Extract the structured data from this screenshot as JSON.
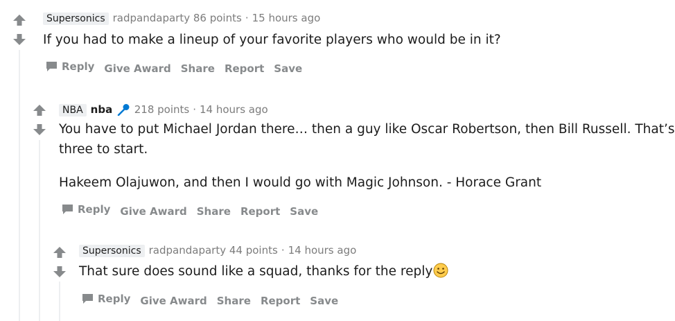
{
  "comments": [
    {
      "flair": "Supersonics",
      "author": "radpandaparty",
      "points": "86 points",
      "time": "15 hours ago",
      "body": [
        "If you had to make a lineup of your favorite players who would be in it?"
      ]
    },
    {
      "flair": "NBA",
      "author": "nba",
      "points": "218 points",
      "time": "14 hours ago",
      "body": [
        "You have to put Michael Jordan there… then a guy like Oscar Robertson, then Bill Russell. That’s",
        "three to start.",
        "Hakeem Olajuwon, and then I would go with Magic Johnson. - Horace Grant"
      ]
    },
    {
      "flair": "Supersonics",
      "author": "radpandaparty",
      "points": "44 points",
      "time": "14 hours ago",
      "body": [
        "That sure does sound like a squad, thanks for the reply"
      ]
    }
  ],
  "actions": {
    "reply": "Reply",
    "give_award": "Give Award",
    "share": "Share",
    "report": "Report",
    "save": "Save"
  },
  "meta_separator": "·",
  "icons": {
    "upvote": "upvote-arrow-icon",
    "downvote": "downvote-arrow-icon",
    "reply": "comment-bubble-icon",
    "mic": "microphone-icon",
    "emoji": "smiley-face-icon"
  },
  "colors": {
    "arrow": "#878a8c",
    "meta": "#7c7c7c",
    "action": "#878a8c",
    "flair_bg": "#edeff1",
    "thread_line": "#edeff1",
    "mic": "#0079d3",
    "emoji": "#ffcc4d"
  }
}
